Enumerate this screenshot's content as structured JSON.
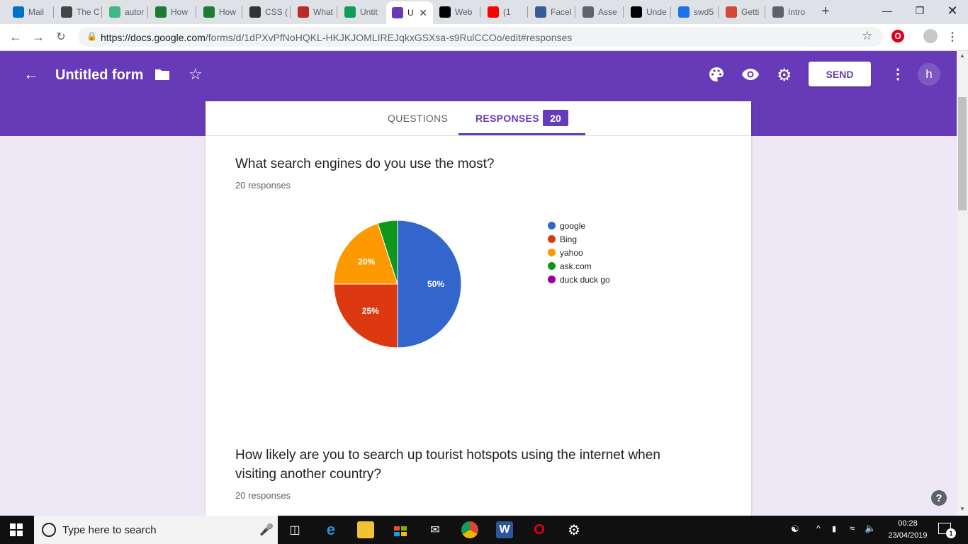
{
  "browser": {
    "tabs": [
      {
        "label": "Mail",
        "icon": "outlook-icon",
        "color": "#0072c6"
      },
      {
        "label": "The C",
        "icon": "blue-toad-icon",
        "color": "#444444"
      },
      {
        "label": "autor",
        "icon": "vue-icon",
        "color": "#41b883"
      },
      {
        "label": "How",
        "icon": "android-icon",
        "color": "#1e7b34"
      },
      {
        "label": "How",
        "icon": "android-icon",
        "color": "#1e7b34"
      },
      {
        "label": "CSS (",
        "icon": "wikipedia-icon",
        "color": "#333333"
      },
      {
        "label": "What",
        "icon": "quora-icon",
        "color": "#b92b27"
      },
      {
        "label": "Untit",
        "icon": "sheets-icon",
        "color": "#0f9d58"
      },
      {
        "label": "U",
        "icon": "forms-icon",
        "color": "#673ab7",
        "active": true
      },
      {
        "label": "Web",
        "icon": "medium-icon",
        "color": "#000000"
      },
      {
        "label": "(1",
        "icon": "youtube-icon",
        "color": "#ff0000"
      },
      {
        "label": "Facel",
        "icon": "facebook-icon",
        "color": "#3b5998"
      },
      {
        "label": "Asse",
        "icon": "page-icon",
        "color": "#5f6368"
      },
      {
        "label": "Unde",
        "icon": "medium-icon",
        "color": "#000000"
      },
      {
        "label": "swd5",
        "icon": "cloud-icon",
        "color": "#1a73e8"
      },
      {
        "label": "Getti",
        "icon": "jenkins-icon",
        "color": "#d24939"
      },
      {
        "label": "Intro",
        "icon": "page-icon",
        "color": "#5f6368"
      }
    ],
    "url_host": "https://docs.google.com",
    "url_path": "/forms/d/1dPXvPfNoHQKL-HKJKJOMLIREJqkxGSXsa-s9RulCCOo/edit#responses"
  },
  "header": {
    "title": "Untitled form",
    "send_label": "SEND",
    "avatar_letter": "h"
  },
  "form_tabs": {
    "questions": "QUESTIONS",
    "responses": "RESPONSES",
    "responses_count": "20"
  },
  "questions": [
    {
      "title": "What search engines do you use the most?",
      "count": "20 responses"
    },
    {
      "title": "How likely are you to search up tourist hotspots using the internet when visiting another country?",
      "count": "20 responses"
    }
  ],
  "chart_data": {
    "type": "pie",
    "categories": [
      "google",
      "Bing",
      "yahoo",
      "ask.com",
      "duck duck go"
    ],
    "values": [
      50,
      25,
      20,
      5,
      0
    ],
    "colors": [
      "#3366cc",
      "#dc3912",
      "#ff9900",
      "#109618",
      "#990099"
    ],
    "data_labels": [
      "50%",
      "25%",
      "20%",
      "",
      ""
    ],
    "legend_position": "right"
  },
  "taskbar": {
    "search_placeholder": "Type here to search",
    "time": "00:28",
    "date": "23/04/2019",
    "notification_count": "1"
  }
}
